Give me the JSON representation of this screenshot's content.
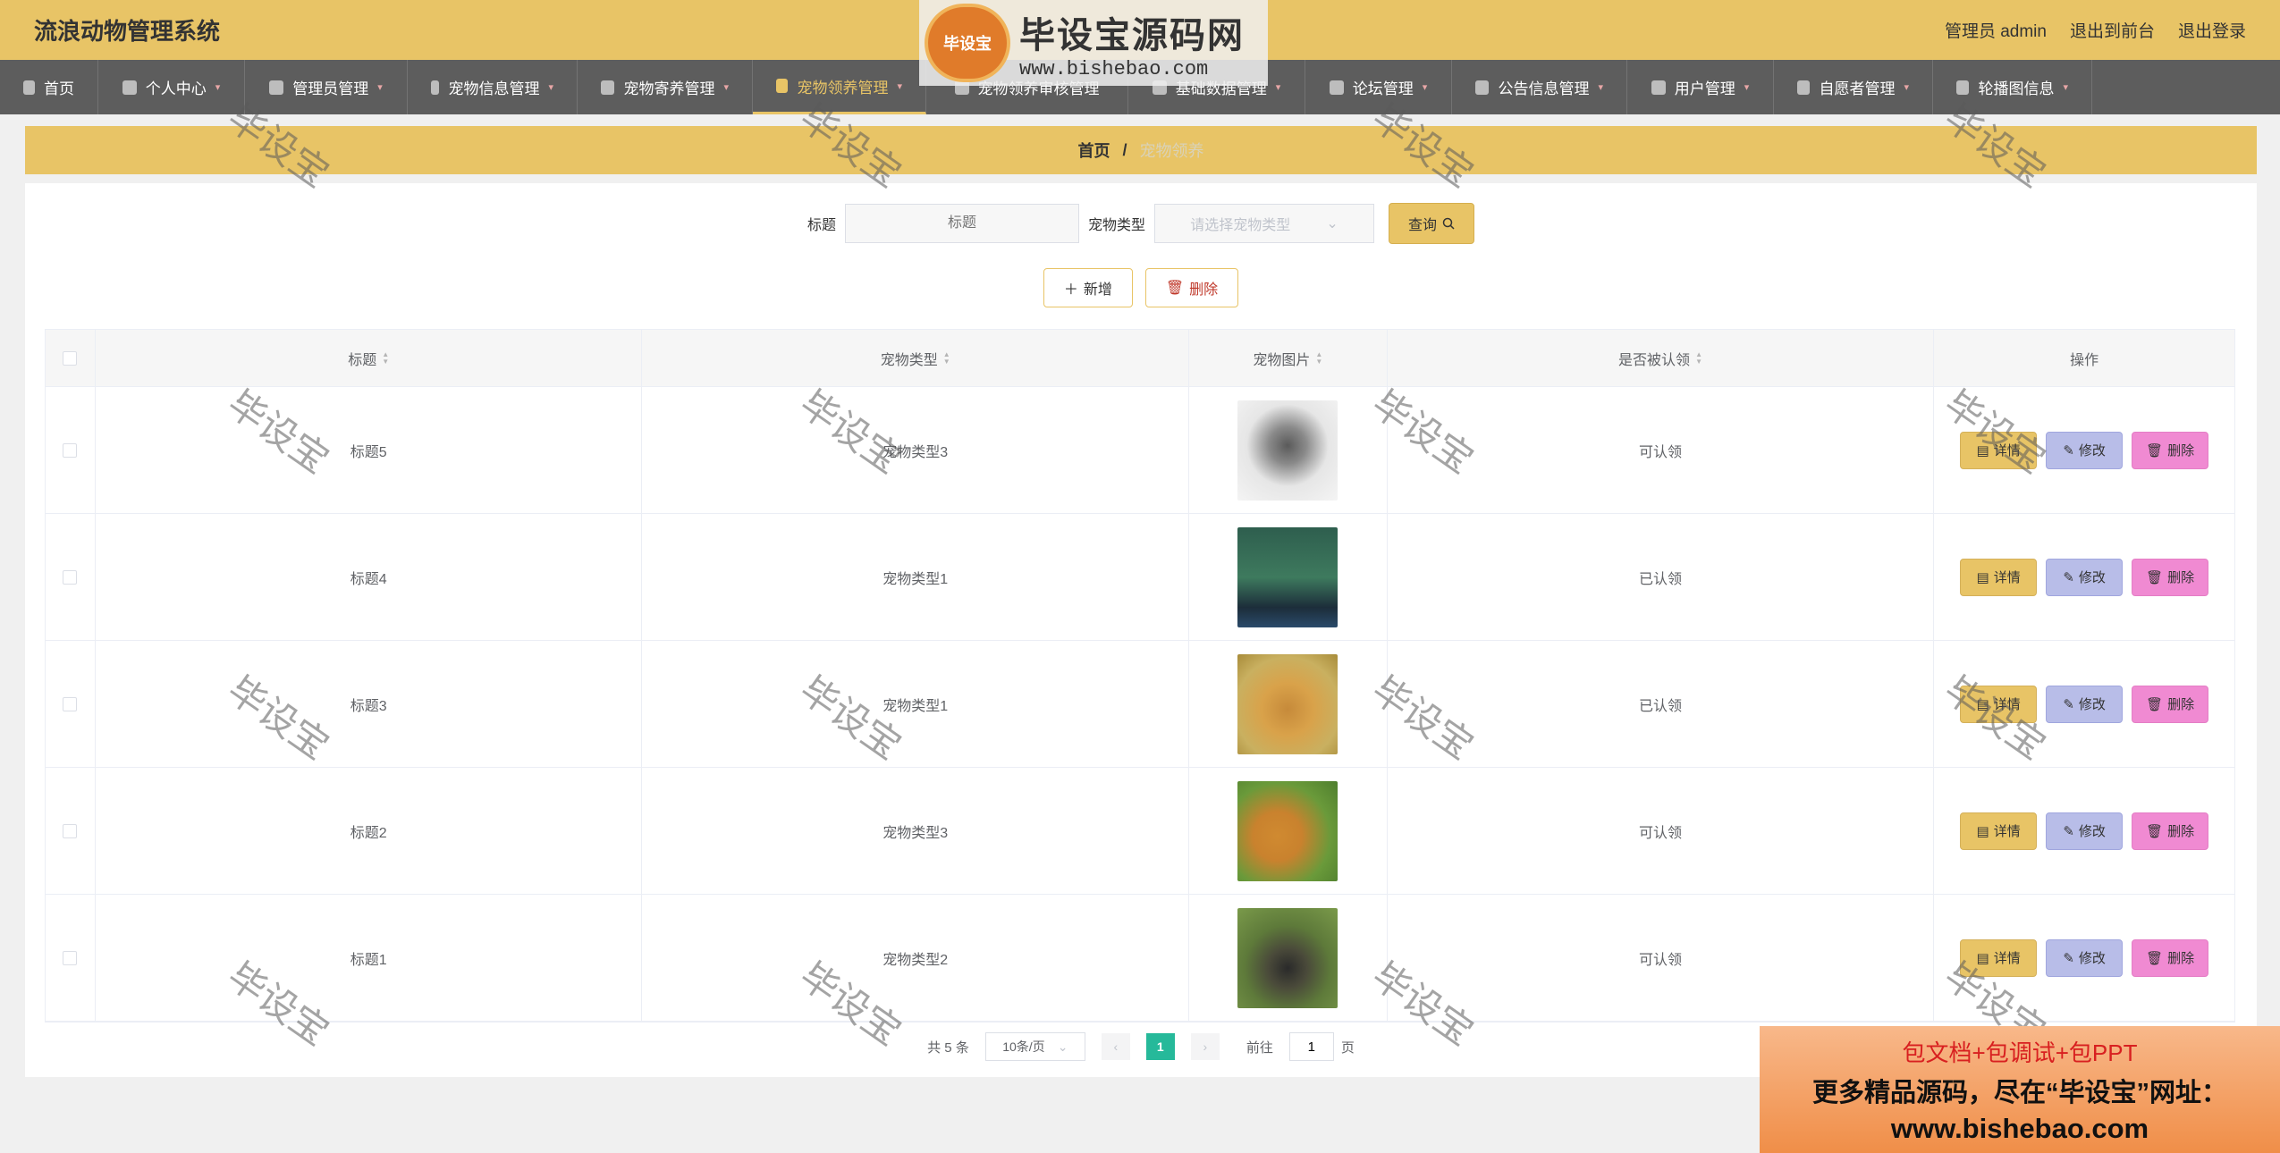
{
  "header": {
    "title": "流浪动物管理系统",
    "user_label": "管理员 admin",
    "to_front": "退出到前台",
    "logout": "退出登录"
  },
  "nav": {
    "items": [
      {
        "label": "首页",
        "icon": "home-icon"
      },
      {
        "label": "个人中心",
        "icon": "user-icon"
      },
      {
        "label": "管理员管理",
        "icon": "clock-icon"
      },
      {
        "label": "宠物信息管理",
        "icon": "person-icon"
      },
      {
        "label": "宠物寄养管理",
        "icon": "briefcase-icon"
      },
      {
        "label": "宠物领养管理",
        "icon": "dashboard-icon"
      },
      {
        "label": "宠物领养审核管理",
        "icon": "circle-icon"
      },
      {
        "label": "基础数据管理",
        "icon": "list-icon"
      },
      {
        "label": "论坛管理",
        "icon": "chat-icon"
      },
      {
        "label": "公告信息管理",
        "icon": "list-icon"
      },
      {
        "label": "用户管理",
        "icon": "send-icon"
      },
      {
        "label": "自愿者管理",
        "icon": "location-icon"
      },
      {
        "label": "轮播图信息",
        "icon": "clipboard-icon"
      }
    ],
    "active_index": 5
  },
  "breadcrumb": {
    "home": "首页",
    "sep": "/",
    "current": "宠物领养"
  },
  "search": {
    "title_label": "标题",
    "title_placeholder": "标题",
    "type_label": "宠物类型",
    "type_placeholder": "请选择宠物类型",
    "query_label": "查询"
  },
  "actions": {
    "add_label": "新增",
    "delete_label": "删除"
  },
  "table": {
    "headers": [
      "标题",
      "宠物类型",
      "宠物图片",
      "是否被认领",
      "操作"
    ],
    "rows": [
      {
        "title": "标题5",
        "type": "宠物类型3",
        "status": "可认领"
      },
      {
        "title": "标题4",
        "type": "宠物类型1",
        "status": "已认领"
      },
      {
        "title": "标题3",
        "type": "宠物类型1",
        "status": "已认领"
      },
      {
        "title": "标题2",
        "type": "宠物类型3",
        "status": "可认领"
      },
      {
        "title": "标题1",
        "type": "宠物类型2",
        "status": "可认领"
      }
    ],
    "op_detail": "详情",
    "op_edit": "修改",
    "op_delete": "删除"
  },
  "pager": {
    "total": "共 5 条",
    "page_size": "10条/页",
    "current_page": "1",
    "goto_label": "前往",
    "goto_value": "1",
    "page_suffix": "页"
  },
  "watermark": {
    "text": "毕设宝",
    "logo_badge": "毕设宝",
    "logo_main": "毕设宝源码网",
    "logo_url": "www.bishebao.com"
  },
  "ad": {
    "line1": "包文档+包调试+包PPT",
    "line2": "更多精品源码，尽在“毕设宝”网址：",
    "line3": "www.bishebao.com"
  },
  "colors": {
    "accent": "#e8c466",
    "nav_bg": "#5d5d5d",
    "pager_active": "#26b99a",
    "edit_btn": "#b8bde8",
    "delete_btn": "#f08ad2"
  }
}
